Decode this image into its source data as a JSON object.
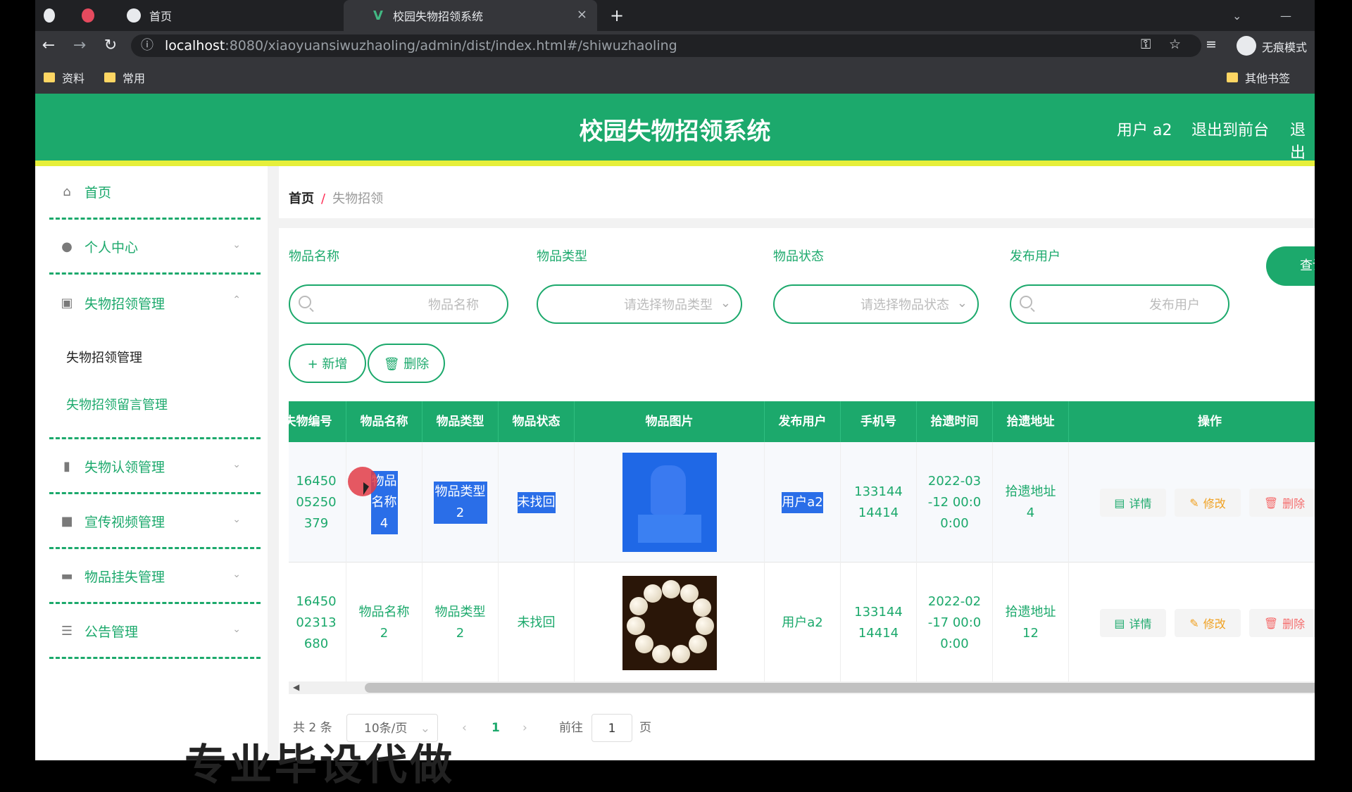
{
  "browser": {
    "tabs": [
      {
        "label": "首页",
        "close": "×"
      },
      {
        "label": "校园失物招领系统",
        "close": "×"
      }
    ],
    "new_tab": "+",
    "url_host": "localhost",
    "url_rest": ":8080/xiaoyuansiwuzhaoling/admin/dist/index.html#/shiwuzhaoling",
    "incognito_label": "无痕模式",
    "bookmarks": [
      "资料",
      "常用"
    ],
    "other_bookmarks": "其他书签"
  },
  "header": {
    "title": "校园失物招领系统",
    "user": "用户 a2",
    "back_front": "退出到前台",
    "logout": "退出"
  },
  "sidebar": {
    "items": [
      {
        "label": "首页",
        "icon": "home-icon"
      },
      {
        "label": "个人中心",
        "icon": "user-icon"
      },
      {
        "label": "失物招领管理",
        "icon": "clipboard-icon"
      },
      {
        "label": "失物认领管理",
        "icon": "chart-icon"
      },
      {
        "label": "宣传视频管理",
        "icon": "video-icon"
      },
      {
        "label": "物品挂失管理",
        "icon": "monitor-icon"
      },
      {
        "label": "公告管理",
        "icon": "list-icon"
      }
    ],
    "subitems": [
      "失物招领管理",
      "失物招领留言管理"
    ]
  },
  "breadcrumb": {
    "home": "首页",
    "sep": "/",
    "current": "失物招领"
  },
  "filters": {
    "name_label": "物品名称",
    "name_placeholder": "物品名称",
    "type_label": "物品类型",
    "type_placeholder": "请选择物品类型",
    "status_label": "物品状态",
    "status_placeholder": "请选择物品状态",
    "user_label": "发布用户",
    "user_placeholder": "发布用户",
    "query": "查询"
  },
  "actions": {
    "add": "+ 新增",
    "delete": "🗑 删除"
  },
  "table": {
    "headers": [
      "失物编号",
      "物品名称",
      "物品类型",
      "物品状态",
      "物品图片",
      "发布用户",
      "手机号",
      "拾遗时间",
      "拾遗地址",
      "操作"
    ],
    "rows": [
      {
        "code": "1645005250379",
        "name": "物品名称4",
        "type": "物品类型2",
        "status": "未找回",
        "user": "用户a2",
        "phone": "13314414414",
        "time": "2022-03-12 00:00:00",
        "addr": "拾遗地址4"
      },
      {
        "code": "1645002313680",
        "name": "物品名称2",
        "type": "物品类型2",
        "status": "未找回",
        "user": "用户a2",
        "phone": "13314414414",
        "time": "2022-02-17 00:00:00",
        "addr": "拾遗地址12"
      }
    ],
    "row_actions": {
      "detail": "详情",
      "edit": "修改",
      "delete": "删除"
    }
  },
  "pager": {
    "total": "共 2 条",
    "size": "10条/页",
    "current": "1",
    "goto": "前往",
    "page_input": "1",
    "page": "页"
  },
  "watermark": "专业毕设代做",
  "colors": {
    "primary": "#1ca96c",
    "accent_bar": "#e6ef3a",
    "edit": "#f0a020",
    "danger": "#f56c6c",
    "selection": "#2a6ee8"
  }
}
